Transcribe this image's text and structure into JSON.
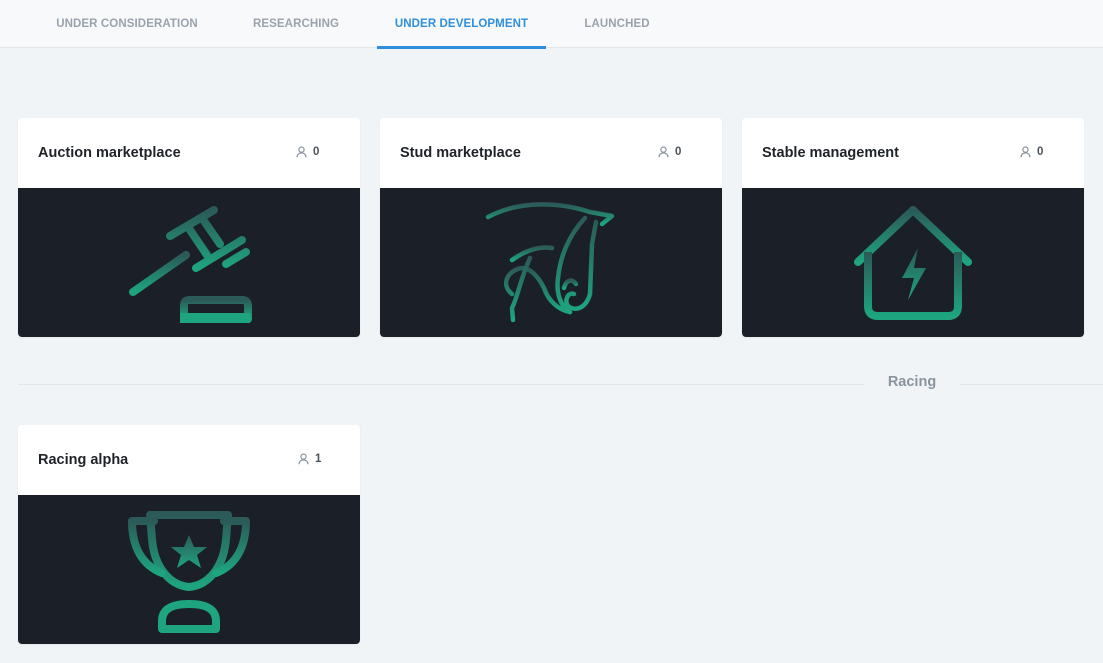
{
  "tabs": [
    {
      "label": "UNDER CONSIDERATION",
      "active": false
    },
    {
      "label": "RESEARCHING",
      "active": false
    },
    {
      "label": "UNDER DEVELOPMENT",
      "active": true
    },
    {
      "label": "LAUNCHED",
      "active": false
    }
  ],
  "cards": [
    {
      "title": "Auction marketplace",
      "votes": "0",
      "icon": "gavel-icon"
    },
    {
      "title": "Stud marketplace",
      "votes": "0",
      "icon": "horse-head-icon"
    },
    {
      "title": "Stable management",
      "votes": "0",
      "icon": "house-bolt-icon"
    }
  ],
  "sections": [
    {
      "label": "Racing",
      "cards": [
        {
          "title": "Racing alpha",
          "votes": "1",
          "icon": "trophy-star-icon"
        }
      ]
    }
  ],
  "colors": {
    "accent": "#2f8fdd",
    "icon_top": "#2b5a58",
    "icon_bottom": "#1ea57f",
    "media_background": "#1b2028",
    "page_background": "#f1f4f7"
  }
}
